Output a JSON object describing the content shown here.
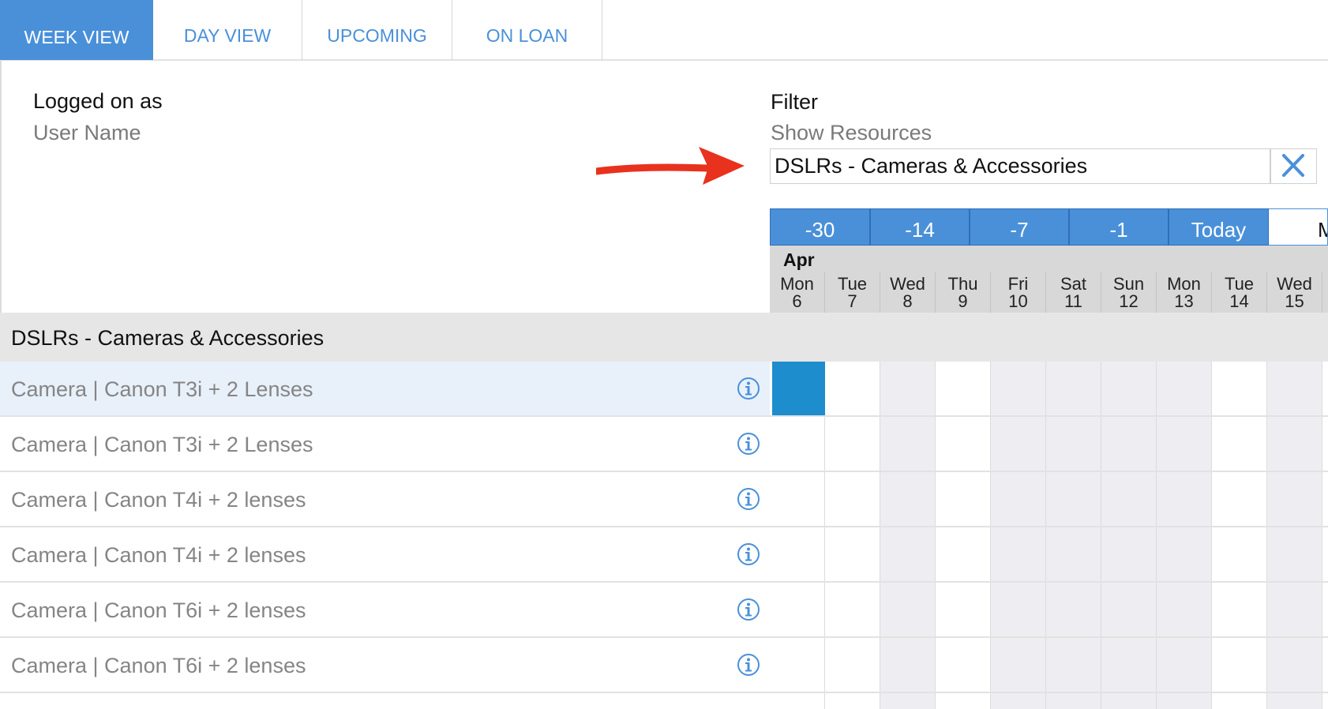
{
  "tabs": [
    {
      "label": "WEEK VIEW",
      "active": true
    },
    {
      "label": "DAY VIEW",
      "active": false
    },
    {
      "label": "UPCOMING",
      "active": false
    },
    {
      "label": "ON LOAN",
      "active": false
    }
  ],
  "user": {
    "label": "Logged on as",
    "name": "User Name"
  },
  "filter": {
    "label": "Filter",
    "sublabel": "Show Resources",
    "value": "DSLRs - Cameras & Accessories",
    "clear_icon": "close-icon"
  },
  "nav_buttons": [
    "-30",
    "-14",
    "-7",
    "-1",
    "Today"
  ],
  "nav_next_partial": "M",
  "calendar": {
    "month": "Apr",
    "days": [
      {
        "name": "Mon",
        "num": "6"
      },
      {
        "name": "Tue",
        "num": "7"
      },
      {
        "name": "Wed",
        "num": "8"
      },
      {
        "name": "Thu",
        "num": "9"
      },
      {
        "name": "Fri",
        "num": "10"
      },
      {
        "name": "Sat",
        "num": "11"
      },
      {
        "name": "Sun",
        "num": "12"
      },
      {
        "name": "Mon",
        "num": "13"
      },
      {
        "name": "Tue",
        "num": "14"
      },
      {
        "name": "Wed",
        "num": "15"
      }
    ]
  },
  "group": {
    "label": "DSLRs - Cameras & Accessories"
  },
  "resources": [
    {
      "label": "Camera | Canon T3i + 2 Lenses",
      "selected": true
    },
    {
      "label": "Camera | Canon T3i + 2 Lenses",
      "selected": false
    },
    {
      "label": "Camera | Canon T4i + 2 lenses",
      "selected": false
    },
    {
      "label": "Camera | Canon T4i + 2 lenses",
      "selected": false
    },
    {
      "label": "Camera | Canon T6i + 2 lenses",
      "selected": false
    },
    {
      "label": "Camera | Canon T6i + 2 lenses",
      "selected": false
    }
  ],
  "colors": {
    "accent": "#4a90d9",
    "booking": "#1d8dce",
    "annotation_arrow": "#e8321e"
  }
}
